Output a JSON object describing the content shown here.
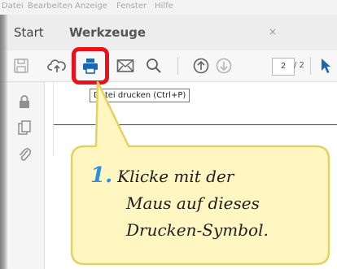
{
  "menu": [
    "Datei",
    "Bearbeiten",
    "Anzeige",
    "Fenster",
    "Hilfe"
  ],
  "tabs": [
    {
      "label": "Start",
      "active": false
    },
    {
      "label": "Werkzeuge",
      "active": true
    }
  ],
  "tab_close": "×",
  "toolbar": {
    "page_current": "2",
    "page_total": "/ 2",
    "icons": [
      "save-icon",
      "upload-icon",
      "print-icon",
      "email-icon",
      "search-icon",
      "page-up-icon",
      "page-down-icon",
      "cursor-icon"
    ]
  },
  "tooltip": "Datei drucken (Ctrl+P)",
  "callout": {
    "number": "1.",
    "lines": [
      "Klicke mit der",
      "Maus auf dieses",
      "Drucken-Symbol."
    ]
  },
  "colors": {
    "highlight": "#e8121b",
    "callout_fill": "#fff6c2",
    "callout_border": "#e3d25e",
    "step_number": "#2f8fe0",
    "print_icon": "#1a66b8",
    "cursor_icon": "#1a66b8",
    "doc_line": "#2b3fb2"
  }
}
